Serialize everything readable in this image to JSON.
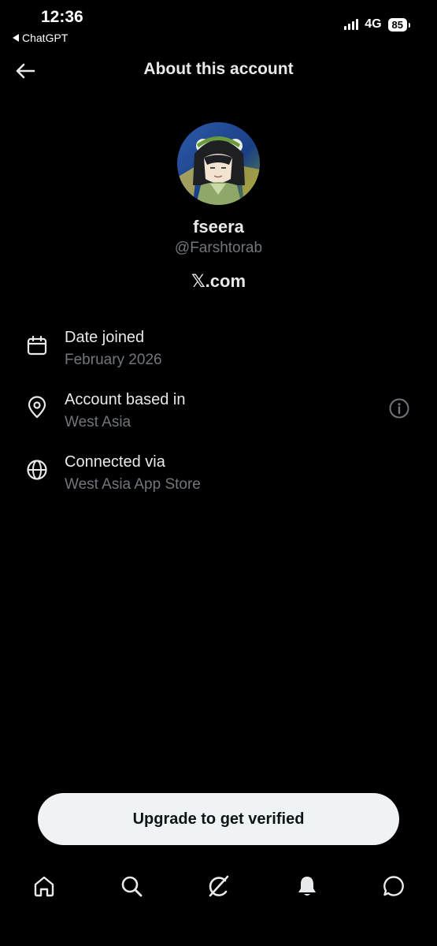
{
  "status_bar": {
    "time": "12:36",
    "back_app": "ChatGPT",
    "network": "4G",
    "battery": "85"
  },
  "header": {
    "title": "About this account",
    "back_icon": "arrow-left-icon"
  },
  "profile": {
    "display_name": "fseera",
    "handle": "@Farshtorab",
    "domain": "𝕏.com"
  },
  "info": [
    {
      "icon": "calendar-icon",
      "label": "Date joined",
      "value": "February 2026"
    },
    {
      "icon": "location-pin-icon",
      "label": "Account based in",
      "value": "West Asia",
      "trailing_icon": "info-icon"
    },
    {
      "icon": "globe-icon",
      "label": "Connected via",
      "value": "West Asia App Store"
    }
  ],
  "upgrade_button": {
    "label": "Upgrade to get verified"
  },
  "bottom_nav": {
    "items": [
      "home-icon",
      "search-icon",
      "grok-icon",
      "notifications-icon",
      "messages-icon"
    ]
  },
  "colors": {
    "background": "#000000",
    "text_primary": "#e7e9ea",
    "text_secondary": "#71767b",
    "button_bg": "#eff3f4"
  }
}
